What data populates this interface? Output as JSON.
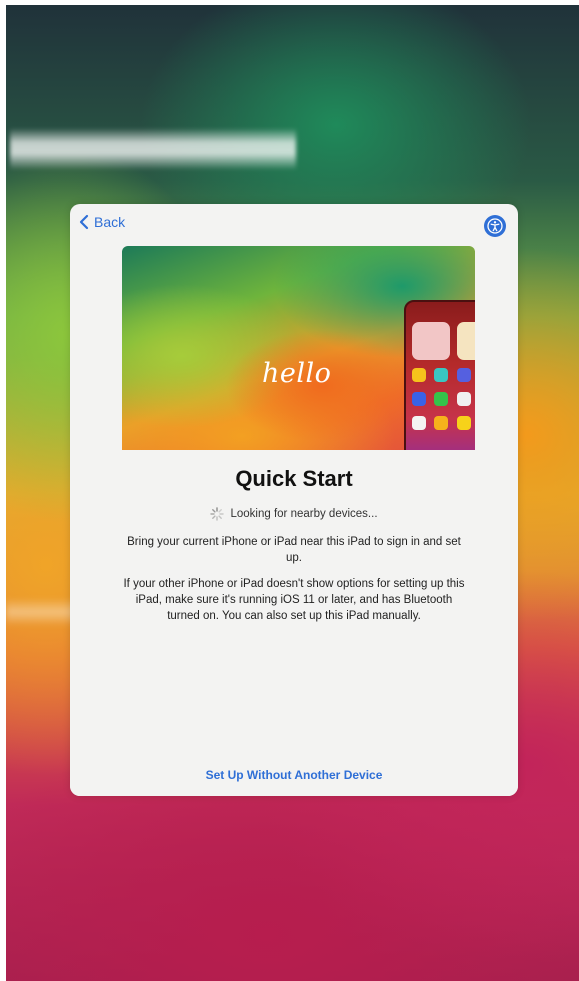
{
  "back_label": "Back",
  "hero": {
    "hello_text": "hello"
  },
  "title": "Quick Start",
  "status_text": "Looking for nearby devices...",
  "paragraph1": "Bring your current iPhone or iPad near this iPad to sign in and set up.",
  "paragraph2": "If your other iPhone or iPad doesn't show options for setting up this iPad, make sure it's running iOS 11 or later, and has Bluetooth turned on. You can also set up this iPad manually.",
  "link_label": "Set Up Without Another Device",
  "colors": {
    "accent": "#2f6fd6",
    "sheet_bg": "#f3f3f2"
  },
  "icons": [
    "chevron-left-icon",
    "accessibility-icon",
    "spinner-icon"
  ]
}
